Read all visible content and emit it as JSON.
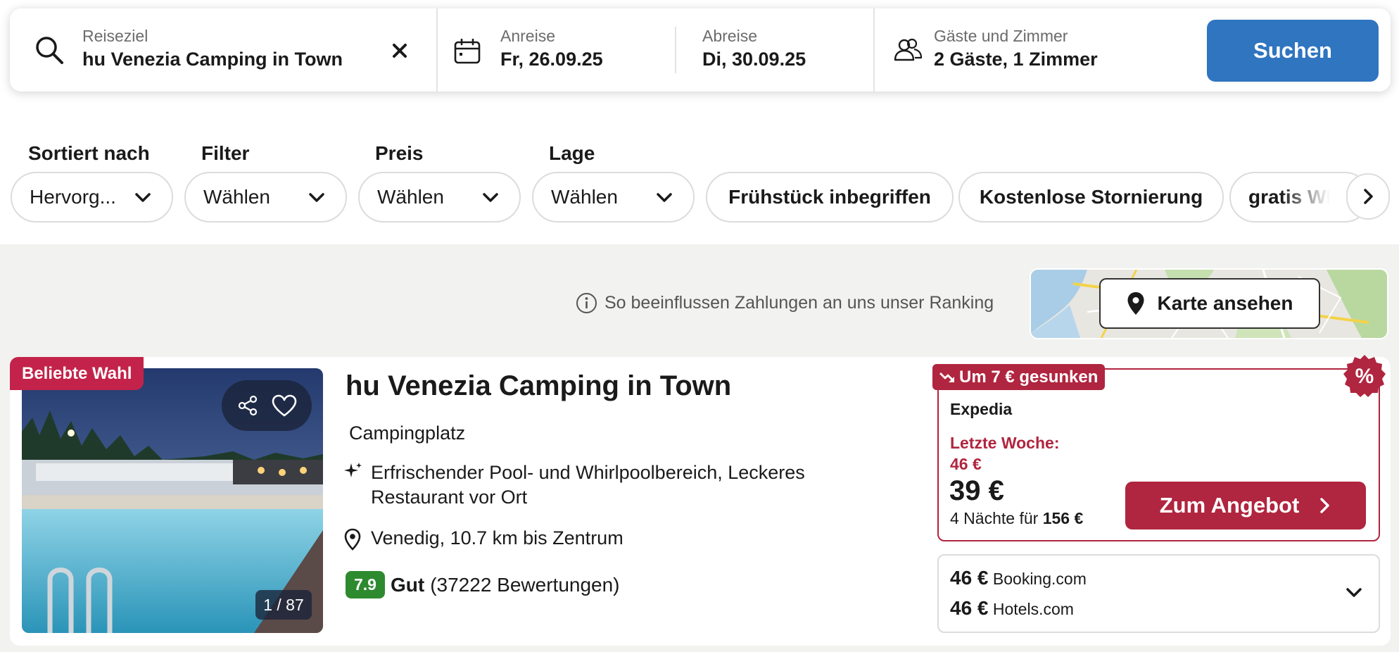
{
  "search": {
    "destination_label": "Reiseziel",
    "destination_value": "hu Venezia Camping in Town",
    "checkin_label": "Anreise",
    "checkin_value": "Fr, 26.09.25",
    "checkout_label": "Abreise",
    "checkout_value": "Di, 30.09.25",
    "guests_label": "Gäste und Zimmer",
    "guests_value": "2 Gäste, 1 Zimmer",
    "search_button": "Suchen"
  },
  "filters": {
    "sort": {
      "label": "Sortiert nach",
      "value": "Hervorg..."
    },
    "filter": {
      "label": "Filter",
      "value": "Wählen"
    },
    "price": {
      "label": "Preis",
      "value": "Wählen"
    },
    "location": {
      "label": "Lage",
      "value": "Wählen"
    },
    "chips": [
      "Frühstück inbegriffen",
      "Kostenlose Stornierung",
      "gratis WLAN"
    ]
  },
  "ranking_info": "So beeinflussen Zahlungen an uns unser Ranking",
  "map_button": "Karte ansehen",
  "result": {
    "badge": "Beliebte Wahl",
    "photo_counter": "1 / 87",
    "title": "hu Venezia Camping in Town",
    "type": "Campingplatz",
    "features": "Erfrischender Pool- und Whirlpoolbereich, Leckeres Restaurant vor Ort",
    "location": "Venedig, 10.7 km bis Zentrum",
    "rating_score": "7.9",
    "rating_word": "Gut",
    "rating_count": "(37222 Bewertungen)",
    "deal": {
      "price_drop": "Um 7 € gesunken",
      "discount_symbol": "%",
      "provider": "Expedia",
      "last_week_label": "Letzte Woche:",
      "last_week_price": "46 €",
      "price": "39 €",
      "nights_text": "4 Nächte für",
      "total": "156 €",
      "button": "Zum Angebot"
    },
    "alternatives": [
      {
        "price": "46 €",
        "provider": "Booking.com"
      },
      {
        "price": "46 €",
        "provider": "Hotels.com"
      }
    ]
  },
  "colors": {
    "primary_blue": "#2f75c0",
    "deal_red": "#b0253f",
    "popular_red": "#c3234a",
    "rating_green": "#2e8a2e"
  }
}
